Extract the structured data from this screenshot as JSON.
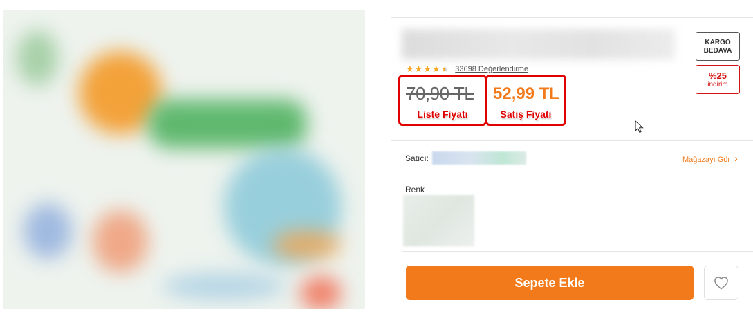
{
  "product": {
    "rating_value": 4.5,
    "review_count_label": "33698 Değerlendirme",
    "list_price": "70,90 TL",
    "list_price_label": "Liste Fiyatı",
    "sale_price": "52,99 TL",
    "sale_price_label": "Satış Fiyatı"
  },
  "badges": {
    "shipping": "KARGO BEDAVA",
    "discount_pct": "%25",
    "discount_label": "indirim"
  },
  "seller": {
    "label": "Satıcı:",
    "store_link": "Mağazayı Gör"
  },
  "variant": {
    "color_label": "Renk"
  },
  "actions": {
    "add_to_cart": "Sepete Ekle"
  },
  "colors": {
    "accent": "#f27a1a",
    "highlight_red": "#e00000",
    "star": "#f5a623"
  },
  "icons": {
    "favorite": "heart-outline-icon",
    "cursor": "mouse-pointer-icon",
    "chevron": "chevron-right-icon"
  }
}
